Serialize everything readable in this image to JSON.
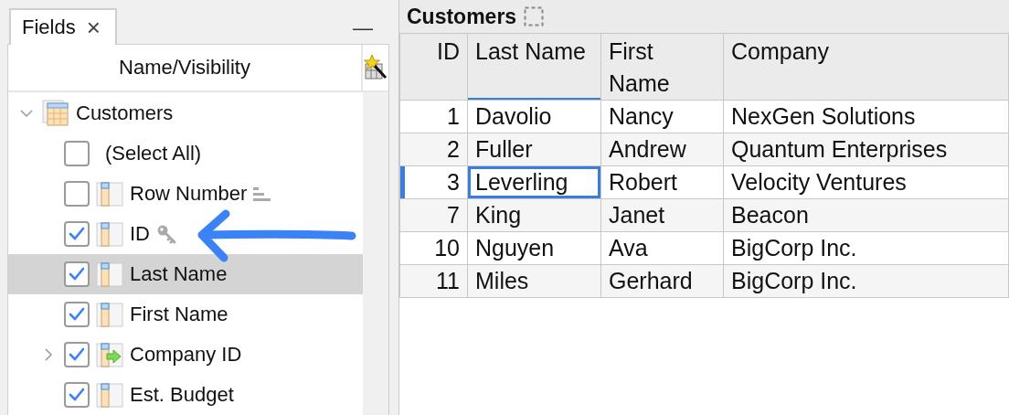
{
  "fields_panel": {
    "tab": {
      "label": "Fields",
      "close": "×",
      "selected": true
    },
    "minimize": "—",
    "column_header": "Name/Visibility",
    "tree": [
      {
        "label": "Customers",
        "kind": "table",
        "expanded": true,
        "selected": false,
        "children": [
          {
            "label": "(Select All)",
            "kind": "select_all",
            "checked": false,
            "selected": false
          },
          {
            "label": "Row Number",
            "kind": "field",
            "checked": false,
            "selected": false,
            "row_number": true
          },
          {
            "label": "ID",
            "kind": "field",
            "checked": true,
            "selected": false,
            "primary_key": true
          },
          {
            "label": "Last Name",
            "kind": "field",
            "checked": true,
            "selected": true
          },
          {
            "label": "First Name",
            "kind": "field",
            "checked": true,
            "selected": false
          },
          {
            "label": "Company ID",
            "kind": "lookup",
            "checked": true,
            "selected": false,
            "expanded": false
          },
          {
            "label": "Est. Budget",
            "kind": "field",
            "checked": true,
            "selected": false
          }
        ]
      }
    ]
  },
  "grid": {
    "title": "Customers",
    "columns": [
      {
        "label": "ID",
        "selected": false
      },
      {
        "label": "Last Name",
        "selected": true
      },
      {
        "label": "First Name",
        "selected": false
      },
      {
        "label": "Company",
        "selected": false
      }
    ],
    "rows": [
      {
        "cells": [
          "1",
          "Davolio",
          "Nancy",
          "NexGen Solutions"
        ],
        "selected": false
      },
      {
        "cells": [
          "2",
          "Fuller",
          "Andrew",
          "Quantum Enterprises"
        ],
        "selected": false
      },
      {
        "cells": [
          "3",
          "Leverling",
          "Robert",
          "Velocity Ventures"
        ],
        "selected": true
      },
      {
        "cells": [
          "7",
          "King",
          "Janet",
          "Beacon"
        ],
        "selected": false
      },
      {
        "cells": [
          "10",
          "Nguyen",
          "Ava",
          "BigCorp Inc."
        ],
        "selected": false
      },
      {
        "cells": [
          "11",
          "Miles",
          "Gerhard",
          "BigCorp Inc."
        ],
        "selected": false
      }
    ]
  }
}
